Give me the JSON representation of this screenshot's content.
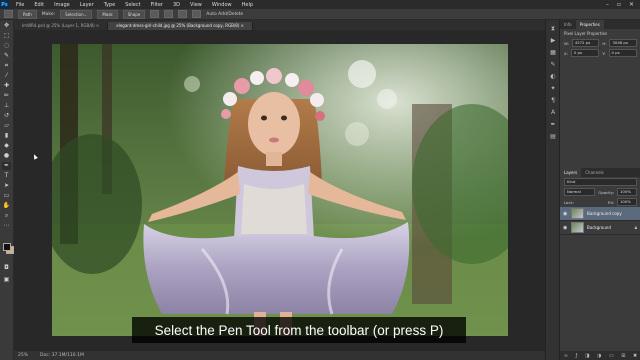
{
  "app": {
    "logo": "Ps"
  },
  "menu": [
    "File",
    "Edit",
    "Image",
    "Layer",
    "Type",
    "Select",
    "Filter",
    "3D",
    "View",
    "Window",
    "Help"
  ],
  "window_controls": [
    "–",
    "▫",
    "✕"
  ],
  "options": {
    "mode": "Path",
    "make_label": "Make:",
    "selection": "Selection...",
    "mask": "Mask",
    "shape": "Shape",
    "auto_label": "Auto Add/Delete"
  },
  "tabs": [
    {
      "label": "ImWR4.psd @ 25% (Layer 1, RGB/8) ×"
    },
    {
      "label": "elegant-dress-girl-child.jpg @ 25% (Background copy, RGB/8) ×"
    }
  ],
  "status": {
    "zoom": "25%",
    "doc": "Doc: 37.1M/110.1M"
  },
  "caption": "Select the Pen Tool from the toolbar (or press P)",
  "panel": {
    "tabs": [
      "Info",
      "Properties"
    ],
    "subtitle": "Pixel Layer Properties",
    "w_label": "W:",
    "w_val": "4572 px",
    "h_label": "H:",
    "h_val": "3048 px",
    "x_label": "X:",
    "x_val": "0 px",
    "y_label": "Y:",
    "y_val": "0 px"
  },
  "layers": {
    "tabs": [
      "Layers",
      "Channels"
    ],
    "kind": "Kind",
    "mode": "Normal",
    "opacity_label": "Opacity:",
    "opacity": "100%",
    "lock_label": "Lock:",
    "fill_label": "Fill:",
    "fill": "100%",
    "items": [
      {
        "name": "Background copy",
        "selected": true
      },
      {
        "name": "Background",
        "selected": false,
        "locked": true
      }
    ]
  },
  "colors": {
    "fg": "#111111",
    "bg": "#d6b28a",
    "accent": "#5b6a7d"
  }
}
